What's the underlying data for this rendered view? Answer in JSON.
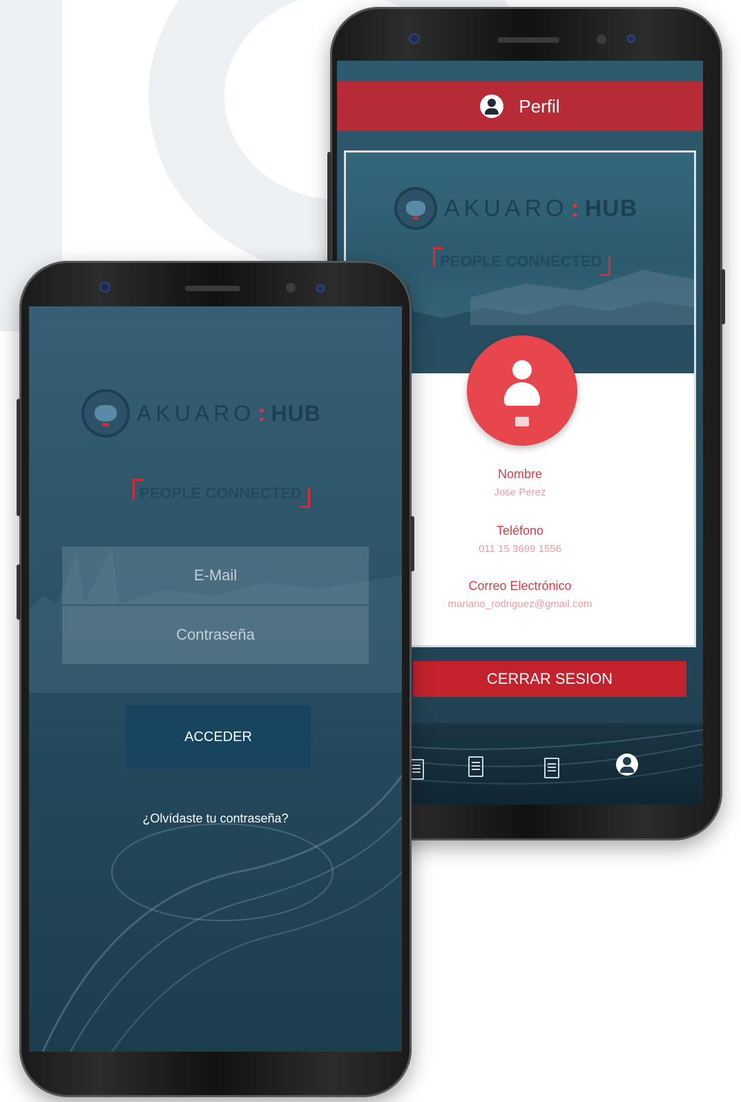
{
  "profile_screen": {
    "header_title": "Perfil",
    "logo": {
      "word": "AKUARO",
      "colon": ":",
      "hub": "HUB"
    },
    "tagline": "PEOPLE CONNECTED",
    "fields": [
      {
        "label": "Nombre",
        "value": "Jose Perez"
      },
      {
        "label": "Teléfono",
        "value": "011 15 3699 1556"
      },
      {
        "label": "Correo Electrónico",
        "value": "mariano_rodriguez@gmail.com"
      }
    ],
    "logout_label": "CERRAR SESION",
    "nav_icons": [
      "document-list-icon",
      "document-edit-icon",
      "certificate-icon",
      "user-profile-icon"
    ]
  },
  "login_screen": {
    "logo": {
      "word": "AKUARO",
      "colon": ":",
      "hub": "HUB"
    },
    "tagline": "PEOPLE CONNECTED",
    "email_placeholder": "E-Mail",
    "password_placeholder": "Contraseña",
    "access_label": "ACCEDER",
    "forgot_label": "¿Olvídaste tu contraseña?"
  },
  "colors": {
    "brand_red": "#c4222d",
    "brand_navy": "#17445e",
    "screen_teal": "#2d5468"
  }
}
